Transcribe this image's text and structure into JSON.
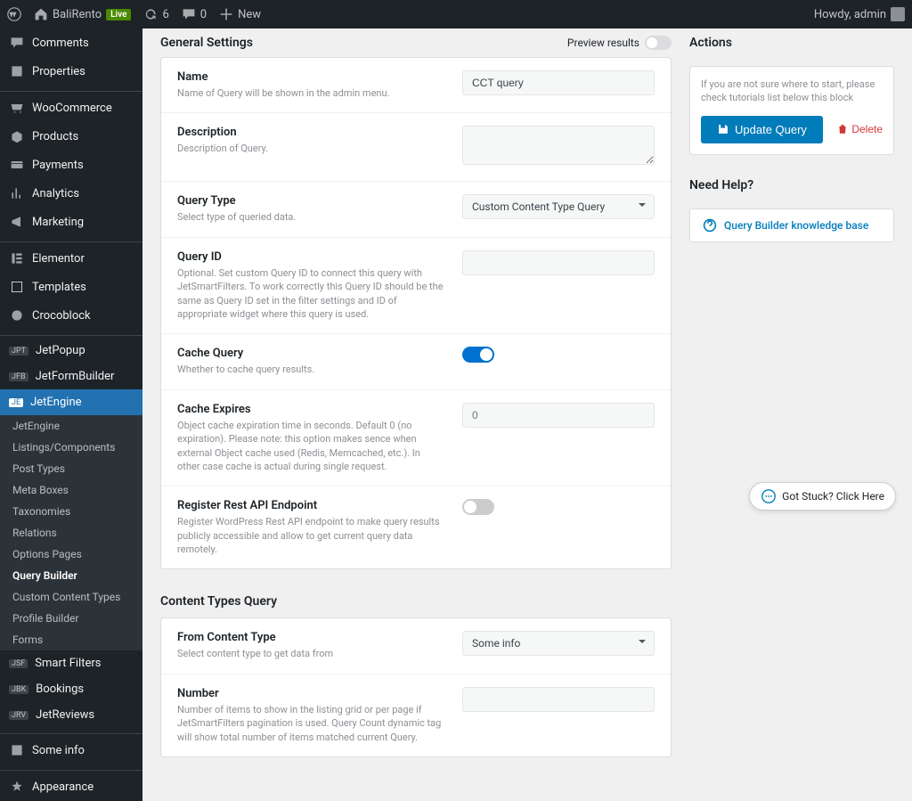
{
  "adminbar": {
    "site_name": "BaliRento",
    "live": "Live",
    "updates": "6",
    "comments": "0",
    "new": "New",
    "howdy": "Howdy, admin"
  },
  "sidebar": {
    "items": [
      {
        "label": "Comments",
        "icon": "comment"
      },
      {
        "label": "Properties",
        "icon": "property"
      },
      {
        "label": "WooCommerce",
        "icon": "woo"
      },
      {
        "label": "Products",
        "icon": "product"
      },
      {
        "label": "Payments",
        "icon": "payment"
      },
      {
        "label": "Analytics",
        "icon": "analytics"
      },
      {
        "label": "Marketing",
        "icon": "marketing"
      },
      {
        "label": "Elementor",
        "icon": "elementor"
      },
      {
        "label": "Templates",
        "icon": "template"
      },
      {
        "label": "Crocoblock",
        "icon": "croco"
      },
      {
        "label": "JetPopup",
        "icon": "jet",
        "tag": "JPT"
      },
      {
        "label": "JetFormBuilder",
        "icon": "jet",
        "tag": "JFB"
      },
      {
        "label": "JetEngine",
        "icon": "jet",
        "tag": "JE",
        "active": true
      },
      {
        "label": "Smart Filters",
        "icon": "jet",
        "tag": "JSF"
      },
      {
        "label": "Bookings",
        "icon": "jet",
        "tag": "JBK"
      },
      {
        "label": "JetReviews",
        "icon": "jet",
        "tag": "JRV"
      },
      {
        "label": "Some info",
        "icon": "info"
      },
      {
        "label": "Appearance",
        "icon": "appearance"
      }
    ],
    "sub": [
      "JetEngine",
      "Listings/Components",
      "Post Types",
      "Meta Boxes",
      "Taxonomies",
      "Relations",
      "Options Pages",
      "Query Builder",
      "Custom Content Types",
      "Profile Builder",
      "Forms"
    ],
    "sub_current": 7
  },
  "header": {
    "title": "General Settings",
    "preview": "Preview results"
  },
  "fields": {
    "name": {
      "label": "Name",
      "desc": "Name of Query will be shown in the admin menu.",
      "value": "CCT query"
    },
    "description": {
      "label": "Description",
      "desc": "Description of Query.",
      "value": ""
    },
    "query_type": {
      "label": "Query Type",
      "desc": "Select type of queried data.",
      "value": "Custom Content Type Query"
    },
    "query_id": {
      "label": "Query ID",
      "desc": "Optional. Set custom Query ID to connect this query with JetSmartFilters. To work correctly this Query ID should be the same as Query ID set in the filter settings and ID of appropriate widget where this query is used.",
      "value": ""
    },
    "cache_query": {
      "label": "Cache Query",
      "desc": "Whether to cache query results.",
      "value": true
    },
    "cache_expires": {
      "label": "Cache Expires",
      "desc": "Object cache expiration time in seconds. Default 0 (no expiration). Please note: this option makes sence when external Object cache used (Redis, Memcached, etc.). In other case cache is actual during single request.",
      "value": "0"
    },
    "rest_api": {
      "label": "Register Rest API Endpoint",
      "desc": "Register WordPress Rest API endpoint to make query results publicly accessible and allow to get current query data remotely.",
      "value": false
    }
  },
  "cct_section": {
    "title": "Content Types Query",
    "from_type": {
      "label": "From Content Type",
      "desc": "Select content type to get data from",
      "value": "Some info"
    },
    "number": {
      "label": "Number",
      "desc": "Number of items to show in the listing grid or per page if JetSmartFilters pagination is used. Query Count dynamic tag will show total number of items matched current Query.",
      "value": ""
    }
  },
  "actions": {
    "title": "Actions",
    "hint": "If you are not sure where to start, please check tutorials list below this block",
    "update": "Update Query",
    "delete": "Delete"
  },
  "help": {
    "title": "Need Help?",
    "link": "Query Builder knowledge base"
  },
  "float": "Got Stuck? Click Here"
}
